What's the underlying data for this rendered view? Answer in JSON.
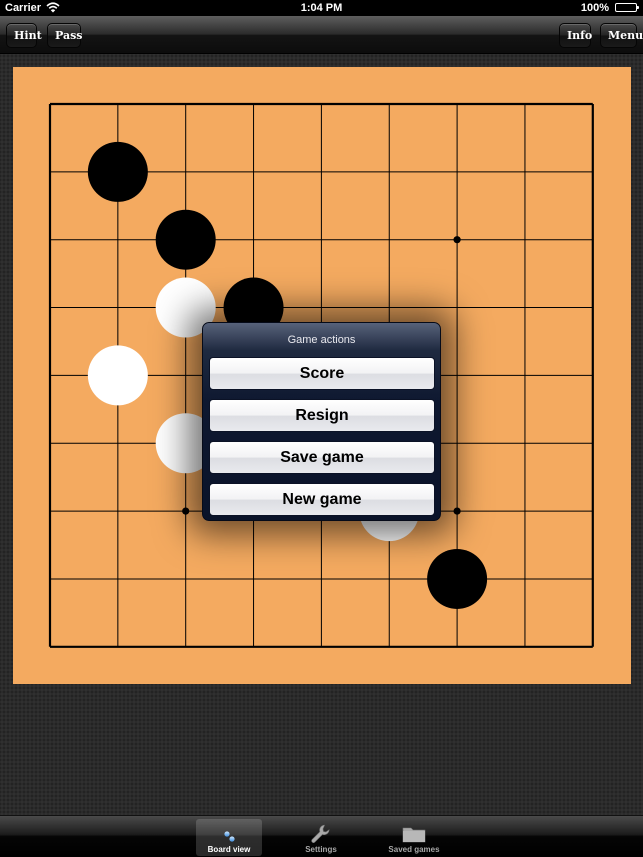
{
  "status_bar": {
    "carrier": "Carrier",
    "time": "1:04 PM",
    "battery": "100%"
  },
  "toolbar": {
    "hint_label": "Hint",
    "pass_label": "Pass",
    "info_label": "Info",
    "menu_label": "Menu"
  },
  "board": {
    "size": 9,
    "star_points": [
      [
        2,
        2
      ],
      [
        6,
        2
      ],
      [
        2,
        6
      ],
      [
        6,
        6
      ]
    ],
    "stones": [
      {
        "col": 1,
        "row": 1,
        "color": "black"
      },
      {
        "col": 2,
        "row": 2,
        "color": "black"
      },
      {
        "col": 2,
        "row": 3,
        "color": "white"
      },
      {
        "col": 3,
        "row": 3,
        "color": "black"
      },
      {
        "col": 1,
        "row": 4,
        "color": "white"
      },
      {
        "col": 2,
        "row": 5,
        "color": "white"
      },
      {
        "col": 5,
        "row": 6,
        "color": "white"
      },
      {
        "col": 6,
        "row": 7,
        "color": "black"
      }
    ],
    "colors": {
      "wood": "#f4aa60",
      "line": "#000000",
      "black_stone": "#000000",
      "white_stone": "#ffffff"
    }
  },
  "game_actions": {
    "title": "Game actions",
    "score_label": "Score",
    "resign_label": "Resign",
    "save_label": "Save game",
    "new_label": "New game"
  },
  "tab_bar": {
    "tabs": [
      {
        "label": "Board view",
        "icon": "board-grid-icon",
        "active": true
      },
      {
        "label": "Settings",
        "icon": "wrench-icon",
        "active": false
      },
      {
        "label": "Saved games",
        "icon": "folder-icon",
        "active": false
      }
    ]
  }
}
